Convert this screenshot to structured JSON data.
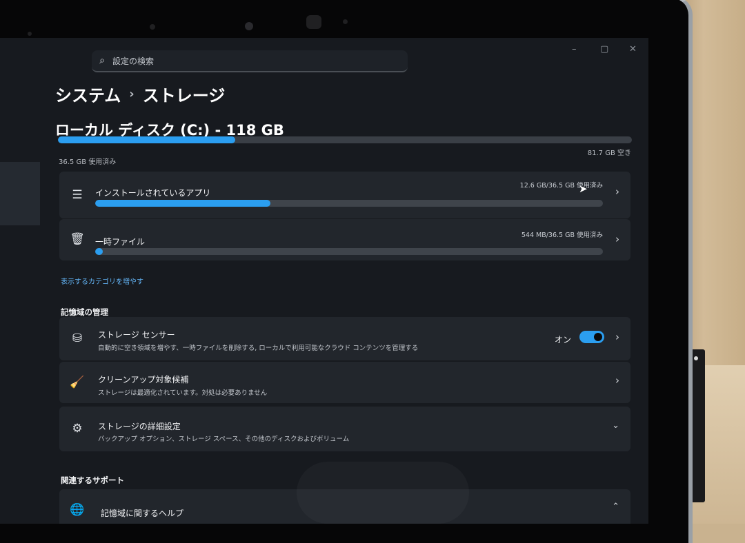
{
  "search": {
    "placeholder": "設定の検索"
  },
  "window_controls": {
    "minimize": "–",
    "maximize": "▢",
    "close": "✕"
  },
  "breadcrumb": {
    "parent": "システム",
    "separator": "›",
    "current": "ストレージ"
  },
  "disk": {
    "title": "ローカル ディスク (C:) - 118 GB",
    "used_label": "36.5 GB 使用済み",
    "free_label": "81.7 GB 空き",
    "used_fraction": 0.309
  },
  "categories": [
    {
      "label": "インストールされているアプリ",
      "amount": "12.6 GB/36.5 GB 使用済み",
      "fraction": 0.345,
      "icon": "list-icon"
    },
    {
      "label": "一時ファイル",
      "amount": "544 MB/36.5 GB 使用済み",
      "fraction": 0.015,
      "icon": "trash-icon"
    }
  ],
  "more_categories_link": "表示するカテゴリを増やす",
  "storage_management": {
    "heading": "記憶域の管理",
    "items": [
      {
        "title": "ストレージ センサー",
        "subtitle": "自動的に空き領域を増やす、一時ファイルを削除する, ローカルで利用可能なクラウド コンテンツを管理する",
        "toggle_label": "オン",
        "toggle_on": true,
        "icon": "database-icon"
      },
      {
        "title": "クリーンアップ対象候補",
        "subtitle": "ストレージは最適化されています。対処は必要ありません",
        "icon": "broom-icon"
      },
      {
        "title": "ストレージの詳細設定",
        "subtitle": "バックアップ オプション、ストレージ スペース、その他のディスクおよびボリューム",
        "icon": "gear-icon"
      }
    ]
  },
  "related_support": {
    "heading": "関連するサポート",
    "items": [
      {
        "title": "記憶域に関するヘルプ",
        "icon": "globe-icon"
      }
    ]
  },
  "colors": {
    "accent": "#2b9ef0",
    "background": "#171a1f",
    "card": "#22262c"
  }
}
